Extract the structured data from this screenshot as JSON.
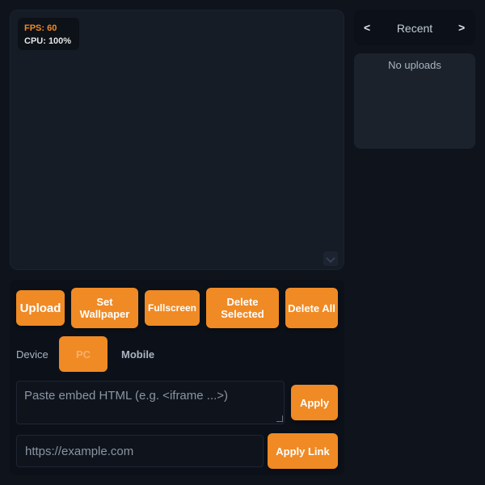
{
  "stats": {
    "fps": "FPS: 60",
    "cpu": "CPU: 100%"
  },
  "toolbar": {
    "upload": "Upload",
    "set_wallpaper": "Set Wallpaper",
    "fullscreen": "Fullscreen",
    "delete_selected": "Delete Selected",
    "delete_all": "Delete All"
  },
  "device": {
    "label": "Device",
    "options": [
      "PC",
      "Mobile"
    ],
    "selected": "PC"
  },
  "embed": {
    "placeholder": "Paste embed HTML (e.g. <iframe ...>)",
    "apply": "Apply"
  },
  "link": {
    "placeholder": "https://example.com",
    "apply": "Apply Link"
  },
  "recent": {
    "prev": "<",
    "title": "Recent",
    "next": ">",
    "empty": "No uploads"
  },
  "colors": {
    "accent": "#f08a24",
    "background": "#0f141c",
    "panel": "#161c25"
  }
}
